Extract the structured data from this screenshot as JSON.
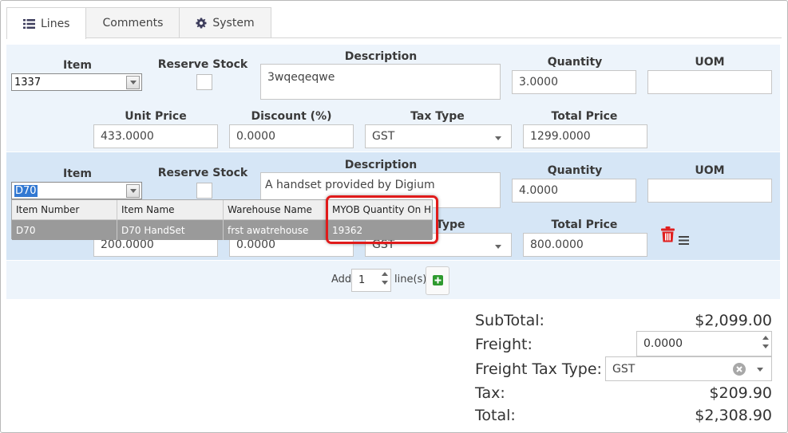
{
  "tabs": [
    {
      "label": "Lines",
      "icon": "list-icon"
    },
    {
      "label": "Comments"
    },
    {
      "label": "System",
      "icon": "gear-icon"
    }
  ],
  "labels": {
    "item": "Item",
    "reserve_stock": "Reserve Stock",
    "description": "Description",
    "quantity": "Quantity",
    "uom": "UOM",
    "unit_price": "Unit Price",
    "discount": "Discount (%)",
    "tax_type": "Tax Type",
    "total_price": "Total Price"
  },
  "line1": {
    "item": "1337",
    "description": "3wqeqeqwe",
    "quantity": "3.0000",
    "uom": "",
    "unit_price": "433.0000",
    "discount": "0.0000",
    "tax_type": "GST",
    "total_price": "1299.0000"
  },
  "line2": {
    "item": "D70",
    "description": "A handset provided by Digium",
    "quantity": "4.0000",
    "uom": "",
    "unit_price": "200.0000",
    "discount": "0.0000",
    "tax_type": "GST",
    "tax_type_label_partial": "Type",
    "total_price": "800.0000"
  },
  "dropdown": {
    "columns": [
      "Item Number",
      "Item Name",
      "Warehouse Name",
      "MYOB Quantity On Ha"
    ],
    "rows": [
      [
        "D70",
        "D70 HandSet",
        "frst awatrehouse",
        "19362"
      ]
    ]
  },
  "add_lines": {
    "prefix": "Add",
    "count": "1",
    "suffix": "line(s)"
  },
  "summary": {
    "subtotal_label": "SubTotal:",
    "subtotal": "$2,099.00",
    "freight_label": "Freight:",
    "freight": "0.0000",
    "freight_tax_label": "Freight Tax Type:",
    "freight_tax": "GST",
    "tax_label": "Tax:",
    "tax": "$209.90",
    "total_label": "Total:",
    "total": "$2,308.90"
  },
  "colors": {
    "line_bg": "#edf4fb",
    "active_line_bg": "#d6e6f6",
    "highlight": "#e01b1b",
    "trash": "#e02020",
    "add_plus": "#2e9a2e"
  }
}
